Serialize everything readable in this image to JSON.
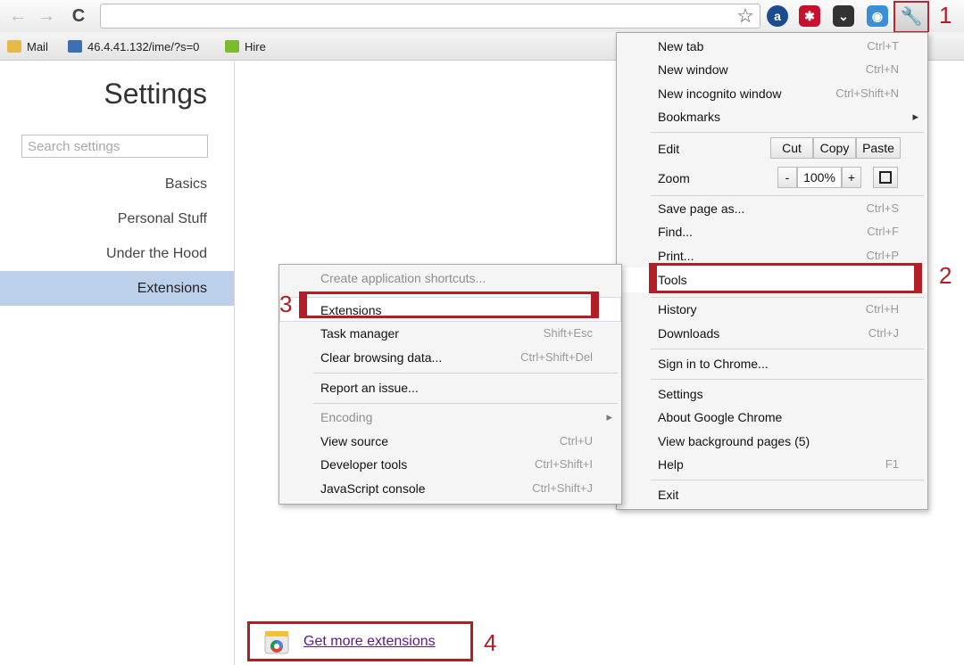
{
  "toolbar": {
    "back": "←",
    "forward": "→",
    "reload": "C",
    "star": "☆",
    "extensions": [
      {
        "name": "a-extension-icon",
        "glyph": "a",
        "color": "#1a4d8f"
      },
      {
        "name": "lastpass-extension-icon",
        "glyph": "✱",
        "color": "#c8102e"
      },
      {
        "name": "pocket-extension-icon",
        "glyph": "⌄",
        "color": "#333333"
      },
      {
        "name": "blue-extension-icon",
        "glyph": "◉",
        "color": "#3c8fd6"
      }
    ],
    "wrench": "🔧"
  },
  "callouts": {
    "one": "1",
    "two": "2",
    "three": "3",
    "four": "4"
  },
  "bookmarks": {
    "mail": "Mail",
    "url": "46.4.41.132/ime/?s=0",
    "hire": "Hire"
  },
  "sidebar": {
    "title": "Settings",
    "search_placeholder": "Search settings",
    "items": [
      "Basics",
      "Personal Stuff",
      "Under the Hood",
      "Extensions"
    ]
  },
  "content": {
    "get_more": "Get more extensions"
  },
  "chrome_menu": {
    "new_tab": {
      "label": "New tab",
      "shortcut": "Ctrl+T"
    },
    "new_window": {
      "label": "New window",
      "shortcut": "Ctrl+N"
    },
    "incognito": {
      "label": "New incognito window",
      "shortcut": "Ctrl+Shift+N"
    },
    "bookmarks": {
      "label": "Bookmarks",
      "arrow": "▸"
    },
    "edit": {
      "label": "Edit",
      "cut": "Cut",
      "copy": "Copy",
      "paste": "Paste"
    },
    "zoom": {
      "label": "Zoom",
      "minus": "-",
      "level": "100%",
      "plus": "+"
    },
    "save": {
      "label": "Save page as...",
      "shortcut": "Ctrl+S"
    },
    "find": {
      "label": "Find...",
      "shortcut": "Ctrl+F"
    },
    "print": {
      "label": "Print...",
      "shortcut": "Ctrl+P"
    },
    "tools": {
      "label": "Tools"
    },
    "history": {
      "label": "History",
      "shortcut": "Ctrl+H"
    },
    "downloads": {
      "label": "Downloads",
      "shortcut": "Ctrl+J"
    },
    "signin": {
      "label": "Sign in to Chrome..."
    },
    "settings": {
      "label": "Settings"
    },
    "about": {
      "label": "About Google Chrome"
    },
    "background": {
      "label": "View background pages (5)"
    },
    "help": {
      "label": "Help",
      "shortcut": "F1"
    },
    "exit": {
      "label": "Exit"
    }
  },
  "tools_menu": {
    "create_shortcuts": {
      "label": "Create application shortcuts..."
    },
    "extensions": {
      "label": "Extensions"
    },
    "task_manager": {
      "label": "Task manager",
      "shortcut": "Shift+Esc"
    },
    "clear_data": {
      "label": "Clear browsing data...",
      "shortcut": "Ctrl+Shift+Del"
    },
    "report": {
      "label": "Report an issue..."
    },
    "encoding": {
      "label": "Encoding",
      "arrow": "▸"
    },
    "view_source": {
      "label": "View source",
      "shortcut": "Ctrl+U"
    },
    "dev_tools": {
      "label": "Developer tools",
      "shortcut": "Ctrl+Shift+I"
    },
    "js_console": {
      "label": "JavaScript console",
      "shortcut": "Ctrl+Shift+J"
    }
  },
  "colors": {
    "highlight": "#b31e26",
    "selected_nav": "#bcd0ea"
  }
}
